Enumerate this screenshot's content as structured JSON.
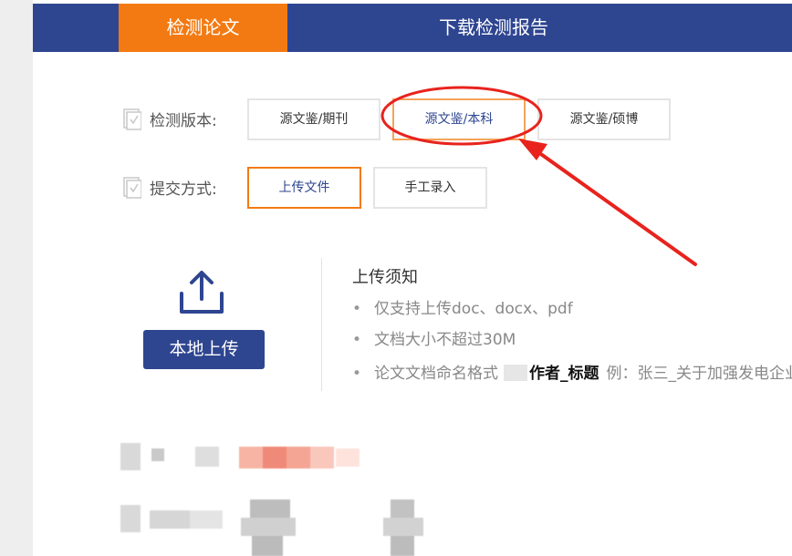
{
  "tabs": [
    {
      "label": "检测论文"
    },
    {
      "label": "下载检测报告"
    }
  ],
  "version": {
    "label": "检测版本:",
    "options": [
      "源文鉴/期刊",
      "源文鉴/本科",
      "源文鉴/硕博"
    ]
  },
  "submit": {
    "label": "提交方式:",
    "options": [
      "上传文件",
      "手工录入"
    ]
  },
  "upload": {
    "button_label": "本地上传"
  },
  "notice": {
    "title": "上传须知",
    "bullet": "•",
    "items": [
      "仅支持上传doc、docx、pdf",
      "文档大小不超过30M"
    ],
    "naming_prefix": "论文文档命名格式",
    "naming_bold": "作者_标题",
    "naming_example": "例：张三_关于加强发电企业"
  },
  "colors": {
    "brand_blue": "#2e4590",
    "accent_orange": "#f37a12",
    "annotation_red": "#e8231d"
  },
  "icons": [
    "checkbox-doc-icon",
    "upload-icon",
    "red-circle-annotation",
    "red-arrow-annotation"
  ]
}
